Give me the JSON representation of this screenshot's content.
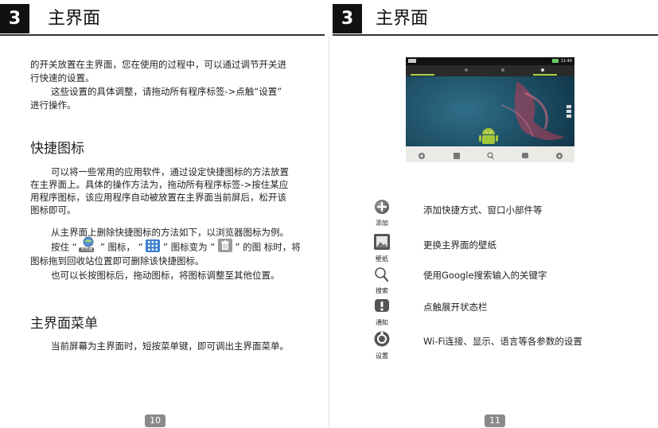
{
  "left_page": {
    "chapter_num": "3",
    "chapter_title": "主界面",
    "para1_l1": "的开关放置在主界面，您在使用的过程中，可以通过调节开关进",
    "para1_l2": "行快速的设置。",
    "para2_l1": "这些设置的具体调整，请拖动所有程序标签->点触“设置”",
    "para2_l2": "进行操作。",
    "heading_shortcut": "快捷图标",
    "para3_l1": "可以将一些常用的应用软件，通过设定快捷图标的方法放置",
    "para3_l2": "在主界面上。具体的操作方法为，拖动所有程序标签->按住某应",
    "para3_l3": "用程序图标，该应用程序自动被放置在主界面当前屏后，松开该",
    "para3_l4": "图标即可。",
    "para4_l1": "从主界面上删除快捷图标的方法如下，以浏览器图标为例。",
    "para4_l2_a": "按住 “",
    "para4_l2_b": "” 图标， “",
    "para4_l2_c": "” 图标变为 “",
    "para4_l2_d": "” 的图 标时，将",
    "browser_icon_label": "浏览器",
    "para4_l3": "图标拖到回收站位置即可删除该快捷图标。",
    "para5": "也可以长按图标后，拖动图标，将图标调整至其他位置。",
    "heading_menu": "主界面菜单",
    "para6": "当前屏幕为主界面时，短按菜单键，即可调出主界面菜单。",
    "page_number": "10"
  },
  "right_page": {
    "chapter_num": "3",
    "chapter_title": "主界面",
    "screenshot": {
      "status_time": "11:40",
      "dock_labels": [
        "添加",
        "壁纸",
        "搜索",
        "通知",
        "设置"
      ]
    },
    "menu_items": [
      {
        "icon": "plus-circle-icon",
        "label": "添加",
        "desc": "添加快捷方式、窗口小部件等"
      },
      {
        "icon": "wallpaper-icon",
        "label": "壁纸",
        "desc": "更换主界面的壁纸"
      },
      {
        "icon": "search-icon",
        "label": "搜索",
        "desc": "使用Google搜索输入的关键字"
      },
      {
        "icon": "notification-icon",
        "label": "通知",
        "desc": "点触展开状态栏"
      },
      {
        "icon": "settings-icon",
        "label": "设置",
        "desc": "Wi-Fi连接、显示、语言等各参数的设置"
      }
    ],
    "page_number": "11"
  },
  "colors": {
    "chapter_box": "#111111",
    "page_number_bg": "#8a8a8a",
    "phone_bg": "#1b4a62"
  }
}
